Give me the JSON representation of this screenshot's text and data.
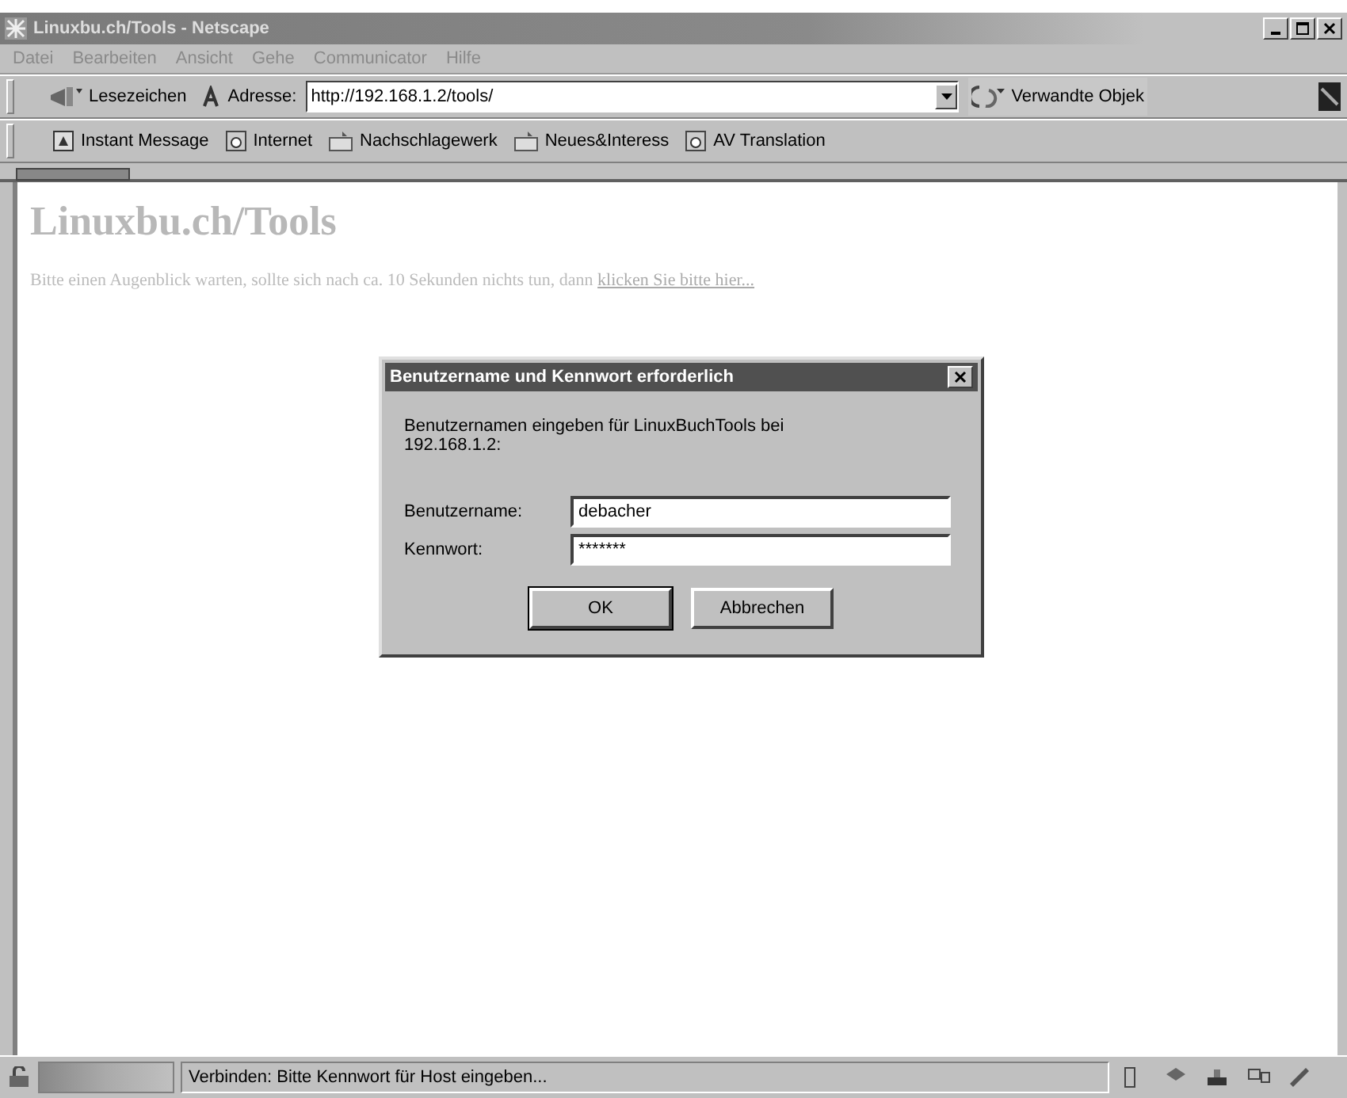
{
  "window": {
    "title": "Linuxbu.ch/Tools - Netscape"
  },
  "menu": [
    "Datei",
    "Bearbeiten",
    "Ansicht",
    "Gehe",
    "Communicator",
    "Hilfe"
  ],
  "navigation_toolbar": {
    "bookmarks": "Lesezeichen",
    "address_label": "Adresse:",
    "address": "http://192.168.1.2/tools/",
    "related": "Verwandte Objek"
  },
  "personal_toolbar": [
    {
      "label": "Instant Message",
      "kind": "message"
    },
    {
      "label": "Internet",
      "kind": "bookmark"
    },
    {
      "label": "Nachschlagewerk",
      "kind": "folder"
    },
    {
      "label": "Neues&Interess",
      "kind": "folder"
    },
    {
      "label": "AV Translation",
      "kind": "bookmark"
    }
  ],
  "page": {
    "heading": "Linuxbu.ch/Tools",
    "text": "Bitte einen Augenblick warten, sollte sich nach ca. 10 Sekunden nichts tun, dann",
    "link": "klicken Sie bitte hier..."
  },
  "dialog": {
    "title": "Benutzername und Kennwort erforderlich",
    "message": "Benutzernamen eingeben für LinuxBuchTools bei 192.168.1.2:",
    "fields": [
      {
        "label": "Benutzername:",
        "value": "debacher"
      },
      {
        "label": "Kennwort:",
        "value": "*******"
      }
    ],
    "buttons": [
      "OK",
      "Abbrechen"
    ]
  },
  "status_bar": {
    "text": "Verbinden: Bitte Kennwort für Host eingeben..."
  }
}
